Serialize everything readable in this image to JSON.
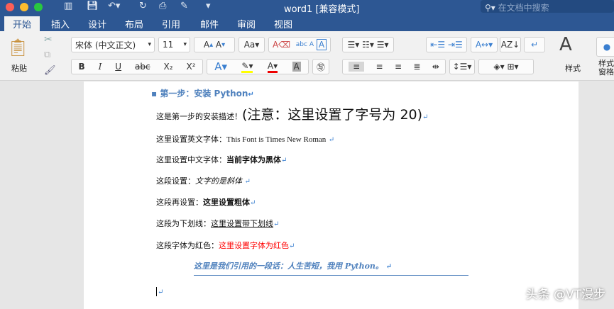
{
  "window": {
    "title": "word1 [兼容模式]",
    "search_placeholder": "在文档中搜索"
  },
  "tabs": [
    "开始",
    "插入",
    "设计",
    "布局",
    "引用",
    "邮件",
    "审阅",
    "视图"
  ],
  "ribbon": {
    "paste": "粘贴",
    "font_name": "宋体 (中文正文)",
    "font_size": "11",
    "styles": "样式",
    "styles_pane": "样式\n窗格",
    "bold": "B",
    "italic": "I",
    "underline": "U",
    "strike": "abc",
    "subscript": "X₂",
    "superscript": "X²"
  },
  "document": {
    "heading": "第一步：安装 Python",
    "line1_a": "这是第一步的安装描述！",
    "line1_b": "(注意：这里设置了字号为 20)",
    "line2_a": "这里设置英文字体：",
    "line2_b": "This Font is Times New Roman",
    "line3_a": "这里设置中文字体：",
    "line3_b": "当前字体为黑体",
    "line4_a": "这段设置：",
    "line4_b": "文字的是斜体",
    "line5_a": "这段再设置：",
    "line5_b": "这里设置粗体",
    "line6_a": "这段为下划线：",
    "line6_b": "这里设置带下划线",
    "line7_a": "这段字体为红色：",
    "line7_b": "这里设置字体为红色",
    "quote": "这里是我们引用的一段话：人生苦短，我用 Python。",
    "para_mark": "↵"
  },
  "watermark": "头条 @VT漫步",
  "colors": {
    "title_bar": "#2d5793",
    "heading": "#4f81bd",
    "red": "#ff0000"
  }
}
